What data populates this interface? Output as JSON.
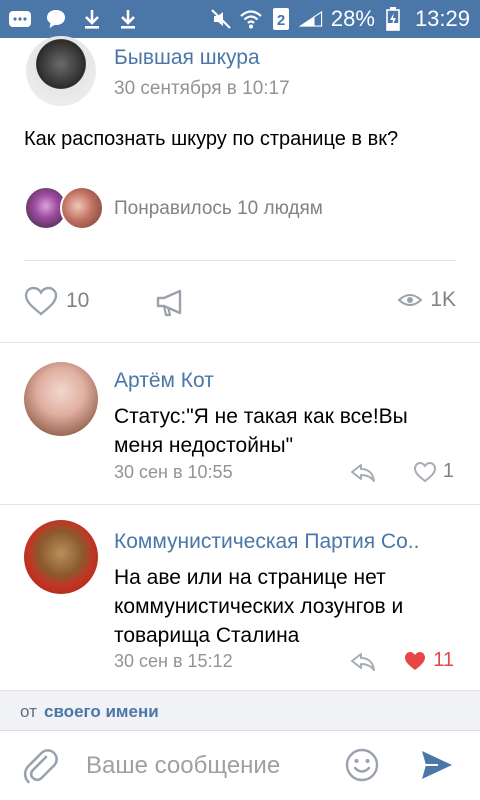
{
  "status_bar": {
    "battery_percent": "28%",
    "time": "13:29",
    "icons": [
      "chat-icon",
      "message-icon",
      "download-icon",
      "download-icon",
      "mute-icon",
      "wifi-icon",
      "sim-2-icon",
      "signal-icon",
      "battery-charging-icon"
    ]
  },
  "post": {
    "author": "Бывшая шкура",
    "date": "30 сентября в 10:17",
    "text": "Как распознать шкуру по странице в вк?",
    "likes_text": "Понравилось 10 людям",
    "like_count": "10",
    "views": "1K"
  },
  "comments": [
    {
      "author": "Артём Кот",
      "text": "Статус:\"Я не такая как все!Вы меня недостойны\"",
      "date": "30 сен в 10:55",
      "likes": "1",
      "liked": false
    },
    {
      "author": "Коммунистическая Партия Со..",
      "text": "На аве или на странице нет коммунистических лозунгов и товарища Сталина",
      "date": "30 сен в 15:12",
      "likes": "11",
      "liked": true
    }
  ],
  "footer": {
    "from_label": "от",
    "from_value": "своего имени",
    "input_placeholder": "Ваше сообщение"
  },
  "colors": {
    "accent": "#4a76a8",
    "like_red": "#e64646",
    "muted": "#939393"
  }
}
